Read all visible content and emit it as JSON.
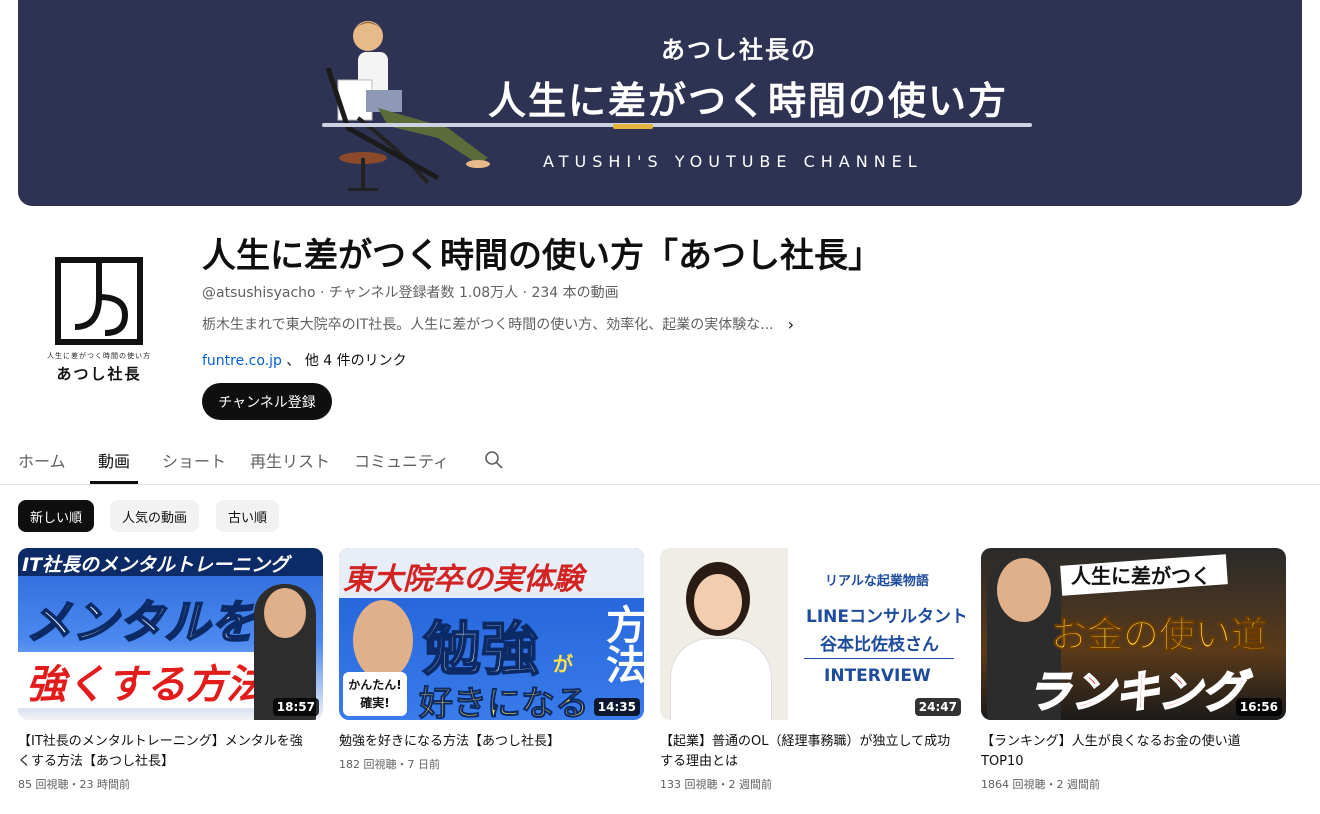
{
  "banner": {
    "subtitle": "あつし社長の",
    "title": "人生に差がつく時間の使い方",
    "english": "ATUSHI'S YOUTUBE CHANNEL"
  },
  "avatar": {
    "tagline": "人生に差がつく時間の使い方",
    "name": "あつし社長"
  },
  "channel": {
    "title": "人生に差がつく時間の使い方「あつし社長」",
    "meta": "@atsushisyacho · チャンネル登録者数 1.08万人 · 234 本の動画",
    "description": "栃木生まれで東大院卒のIT社長。人生に差がつく時間の使い方、効率化、起業の実体験な...",
    "link": "funtre.co.jp",
    "link_sep": "、",
    "more_links": "他 4 件のリンク",
    "subscribe": "チャンネル登録"
  },
  "tabs": [
    "ホーム",
    "動画",
    "ショート",
    "再生リスト",
    "コミュニティ"
  ],
  "chips": [
    "新しい順",
    "人気の動画",
    "古い順"
  ],
  "videos": [
    {
      "thumb_top": "IT社長のメンタルトレーニング",
      "thumb_main": "メンタルを",
      "thumb_sub": "強くする方法",
      "duration": "18:57",
      "title": "【IT社長のメンタルトレーニング】メンタルを強くする方法【あつし社長】",
      "meta": "85 回視聴・23 時間前"
    },
    {
      "thumb_top": "東大院卒の実体験",
      "thumb_main": "勉強",
      "thumb_sub": "好きになる",
      "thumb_side": "方法",
      "thumb_badge": "かんたん!確実!",
      "thumb_ga": "が",
      "duration": "14:35",
      "title": "勉強を好きになる方法【あつし社長】",
      "meta": "182 回視聴・7 日前"
    },
    {
      "thumb_line1": "リアルな起業物語",
      "thumb_line2": "LINEコンサルタント",
      "thumb_line3": "谷本比佐枝さん",
      "thumb_line4": "INTERVIEW",
      "duration": "24:47",
      "title": "【起業】普通のOL（経理事務職）が独立して成功する理由とは",
      "meta": "133 回視聴・2 週間前"
    },
    {
      "thumb_top": "人生に差がつく",
      "thumb_main": "お金の使い道",
      "thumb_sub": "ランキング",
      "duration": "16:56",
      "title": "【ランキング】人生が良くなるお金の使い道TOP10",
      "meta": "1864 回視聴・2 週間前"
    }
  ]
}
